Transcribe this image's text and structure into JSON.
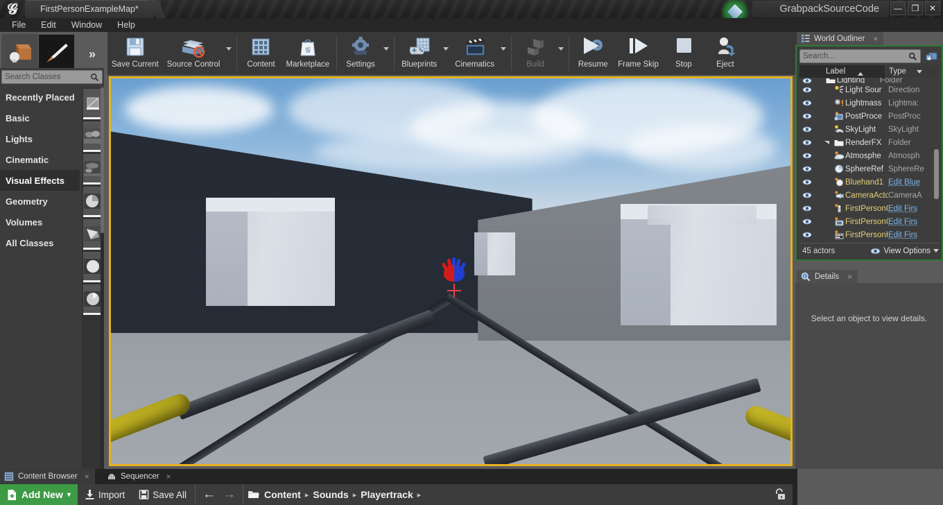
{
  "titlebar": {
    "app_logo": "unreal-engine-logo",
    "map_tab": "FirstPersonExampleMap*",
    "project_name": "GrabpackSourceCode",
    "minimize": "—",
    "maximize": "❐",
    "close": "✕"
  },
  "menubar": {
    "items": [
      "File",
      "Edit",
      "Window",
      "Help"
    ]
  },
  "modes": {
    "tabs": [
      {
        "name": "place-mode",
        "icon": "place-actors-icon",
        "selected": false
      },
      {
        "name": "paint-mode",
        "icon": "paint-brush-icon",
        "selected": true
      }
    ],
    "expander": "»"
  },
  "place_panel": {
    "search_placeholder": "Search Classes",
    "categories": [
      {
        "label": "Recently Placed",
        "selected": false
      },
      {
        "label": "Basic",
        "selected": false
      },
      {
        "label": "Lights",
        "selected": false
      },
      {
        "label": "Cinematic",
        "selected": false
      },
      {
        "label": "Visual Effects",
        "selected": true
      },
      {
        "label": "Geometry",
        "selected": false
      },
      {
        "label": "Volumes",
        "selected": false
      },
      {
        "label": "All Classes",
        "selected": false
      }
    ]
  },
  "toolbar": {
    "groups": [
      {
        "buttons": [
          {
            "label": "Save Current",
            "icon": "floppy-disk-icon",
            "caret": false,
            "disabled": false
          },
          {
            "label": "Source Control",
            "icon": "source-control-icon",
            "caret": true,
            "disabled": false
          }
        ]
      },
      {
        "buttons": [
          {
            "label": "Content",
            "icon": "content-grid-icon",
            "caret": false,
            "disabled": false
          },
          {
            "label": "Marketplace",
            "icon": "marketplace-bag-icon",
            "caret": false,
            "disabled": false
          }
        ]
      },
      {
        "buttons": [
          {
            "label": "Settings",
            "icon": "gear-icon",
            "caret": true,
            "disabled": false
          }
        ]
      },
      {
        "buttons": [
          {
            "label": "Blueprints",
            "icon": "blueprint-gamepad-icon",
            "caret": true,
            "disabled": false
          },
          {
            "label": "Cinematics",
            "icon": "clapperboard-icon",
            "caret": true,
            "disabled": false
          }
        ]
      },
      {
        "buttons": [
          {
            "label": "Build",
            "icon": "build-boxes-icon",
            "caret": true,
            "disabled": true
          }
        ]
      },
      {
        "buttons": [
          {
            "label": "Resume",
            "icon": "resume-play-icon",
            "caret": false,
            "disabled": false
          },
          {
            "label": "Frame Skip",
            "icon": "frame-skip-icon",
            "caret": false,
            "disabled": false
          },
          {
            "label": "Stop",
            "icon": "stop-square-icon",
            "caret": false,
            "disabled": false
          },
          {
            "label": "Eject",
            "icon": "eject-person-icon",
            "caret": false,
            "disabled": false
          }
        ]
      }
    ]
  },
  "viewport": {
    "pie_border_color": "#e6b31e",
    "crosshair_color": "#e8414a",
    "hand_colors": {
      "left": "#d41b1b",
      "right": "#1f3fd0"
    },
    "arm_color": "#c0b227",
    "sky_color": "#8fb8dd",
    "floor_color": "#9aa0a6",
    "wall_dark_color": "#262c36",
    "wall_light_color": "#7a7f85",
    "box_color": "#d5dae1"
  },
  "world_outliner": {
    "tab_title": "World Outliner",
    "tab_icon": "outliner-list-icon",
    "close_icon": "×",
    "search_placeholder": "Search...",
    "add_icon": "add-folder-icon",
    "columns": [
      {
        "label": "Label",
        "sort": "asc"
      },
      {
        "label": "Type",
        "sort": "desc"
      }
    ],
    "rows": [
      {
        "label": "Lighting",
        "type": "Folder",
        "indent": 1,
        "icon": "folder-icon",
        "kind": "folder",
        "partial": true
      },
      {
        "label": "Light Sour",
        "type": "Direction",
        "indent": 2,
        "icon": "directional-light-icon",
        "kind": "actor"
      },
      {
        "label": "Lightmass",
        "type": "Lightma:",
        "indent": 2,
        "icon": "lightmass-icon",
        "kind": "actor"
      },
      {
        "label": "PostProce",
        "type": "PostProc",
        "indent": 2,
        "icon": "postprocess-icon",
        "kind": "actor"
      },
      {
        "label": "SkyLight",
        "type": "SkyLight",
        "indent": 2,
        "icon": "skylight-icon",
        "kind": "actor"
      },
      {
        "label": "RenderFX",
        "type": "Folder",
        "indent": 1,
        "icon": "folder-icon",
        "kind": "folder"
      },
      {
        "label": "Atmosphe",
        "type": "Atmosph",
        "indent": 2,
        "icon": "atmosphere-icon",
        "kind": "actor"
      },
      {
        "label": "SphereRef",
        "type": "SphereRe",
        "indent": 2,
        "icon": "sphere-reflection-icon",
        "kind": "actor"
      },
      {
        "label": "Bluehand1",
        "type": "Edit Blue",
        "indent": 2,
        "icon": "blueprint-sphere-icon",
        "kind": "blueprint"
      },
      {
        "label": "CameraActo",
        "type": "CameraA",
        "indent": 2,
        "icon": "camera-actor-icon",
        "kind": "blueprint"
      },
      {
        "label": "FirstPersonC",
        "type": "Edit Firs",
        "indent": 2,
        "icon": "character-icon",
        "kind": "blueprint"
      },
      {
        "label": "FirstPersonG",
        "type": "Edit Firs",
        "indent": 2,
        "icon": "gamemode-icon",
        "kind": "blueprint"
      },
      {
        "label": "FirstPersonH",
        "type": "Edit Firs",
        "indent": 2,
        "icon": "hud-icon",
        "kind": "blueprint"
      }
    ],
    "footer": {
      "actor_count": "45 actors",
      "view_options": "View Options",
      "view_icon": "eye-icon"
    }
  },
  "details": {
    "tab_title": "Details",
    "tab_icon": "details-magnifier-icon",
    "close_icon": "×",
    "empty_message": "Select an object to view details."
  },
  "content_browser": {
    "tabs": [
      {
        "label": "Content Browser",
        "icon": "content-browser-icon",
        "active": true,
        "close": "×"
      },
      {
        "label": "Sequencer",
        "icon": "sequencer-icon",
        "active": false,
        "close": "×"
      }
    ],
    "add_new": {
      "label": "Add New",
      "icon": "add-new-file-icon",
      "caret": "▾",
      "color": "#3d9b45"
    },
    "import": {
      "label": "Import",
      "icon": "import-download-icon"
    },
    "save_all": {
      "label": "Save All",
      "icon": "save-all-disk-icon"
    },
    "nav": {
      "back": "←",
      "forward": "→",
      "folder_icon": "folder-open-icon"
    },
    "breadcrumb": [
      "Content",
      "Sounds",
      "Playertrack"
    ],
    "breadcrumb_arrow": "▸",
    "lock_icon": "unlock-icon"
  }
}
